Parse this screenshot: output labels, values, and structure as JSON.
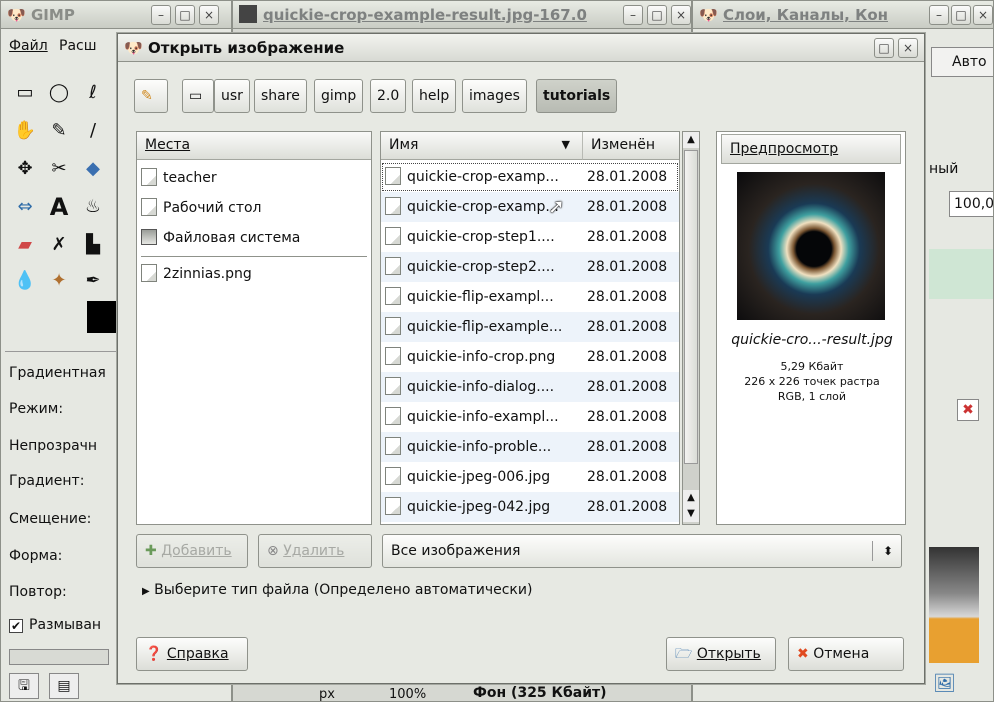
{
  "background": {
    "gimp_title": "GIMP",
    "gimp_menu": [
      "Файл",
      "Расш"
    ],
    "result_title": "quickie-crop-example-result.jpg-167.0",
    "layers_title": "Слои, Каналы, Кон",
    "layers_mode": "Авто",
    "layers_mode_partial": "ный",
    "layers_opacity": "100,0",
    "tool_options": {
      "title": "Градиентная",
      "labels": [
        "Режим:",
        "Непрозрачн",
        "Градиент:",
        "Смещение:",
        "Форма:",
        "Повтор:"
      ],
      "checkbox_label": "Размыван"
    },
    "statusbar": {
      "unit": "px",
      "zoom": "100%",
      "info": "Фон (325 Кбайт)"
    }
  },
  "dialog": {
    "title": "Открыть изображение",
    "path": [
      "usr",
      "share",
      "gimp",
      "2.0",
      "help",
      "images",
      "tutorials"
    ],
    "places": {
      "header": "Места",
      "items": [
        "teacher",
        "Рабочий стол",
        "Файловая система"
      ],
      "bookmarks": [
        "2zinnias.png"
      ]
    },
    "files": {
      "col_name": "Имя",
      "col_modified": "Изменён",
      "rows": [
        {
          "name": "quickie-crop-examp...",
          "date": "28.01.2008"
        },
        {
          "name": "quickie-crop-examp...",
          "date": "28.01.2008"
        },
        {
          "name": "quickie-crop-step1....",
          "date": "28.01.2008"
        },
        {
          "name": "quickie-crop-step2....",
          "date": "28.01.2008"
        },
        {
          "name": "quickie-flip-exampl...",
          "date": "28.01.2008"
        },
        {
          "name": "quickie-flip-example...",
          "date": "28.01.2008"
        },
        {
          "name": "quickie-info-crop.png",
          "date": "28.01.2008"
        },
        {
          "name": "quickie-info-dialog....",
          "date": "28.01.2008"
        },
        {
          "name": "quickie-info-exampl...",
          "date": "28.01.2008"
        },
        {
          "name": "quickie-info-proble...",
          "date": "28.01.2008"
        },
        {
          "name": "quickie-jpeg-006.jpg",
          "date": "28.01.2008"
        },
        {
          "name": "quickie-jpeg-042.jpg",
          "date": "28.01.2008"
        }
      ]
    },
    "preview": {
      "header": "Предпросмотр",
      "filename": "quickie-cro...-result.jpg",
      "size": "5,29 Кбайт",
      "dimensions": "226 x 226 точек растра",
      "mode": "RGB, 1 слой"
    },
    "add_button": "Добавить",
    "remove_button": "Удалить",
    "filter": "Все изображения",
    "file_type_expander": "Выберите тип файла (Определено автоматически)",
    "help_button": "Справка",
    "open_button": "Открыть",
    "cancel_button": "Отмена"
  }
}
